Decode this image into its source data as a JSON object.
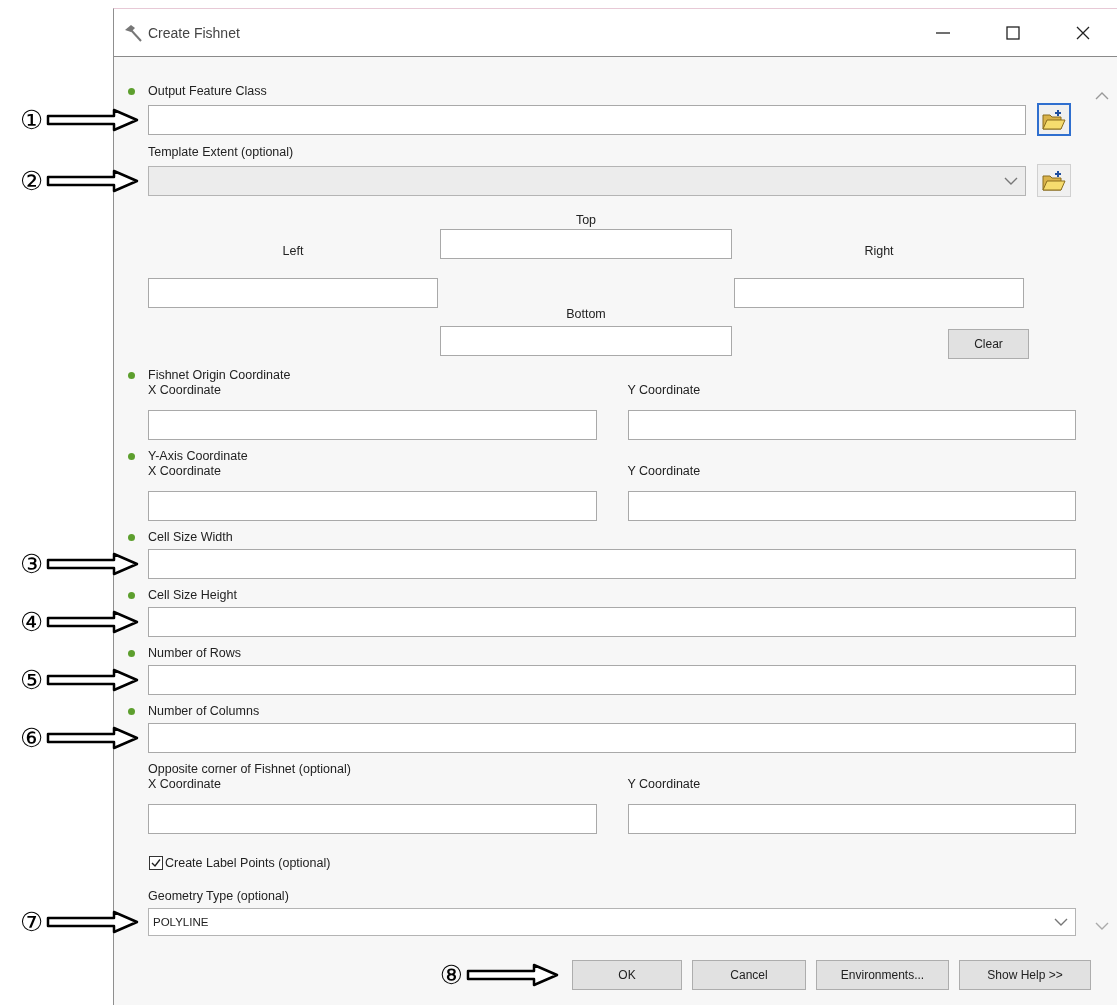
{
  "window": {
    "title": "Create Fishnet"
  },
  "params": [
    {
      "kind": "path",
      "label": "Output Feature Class",
      "required": true,
      "marker": "①",
      "browse": {
        "focused": true
      }
    },
    {
      "kind": "dropdown",
      "label": "Template Extent (optional)",
      "required": false,
      "marker": "②",
      "browse": {
        "focused": false
      }
    },
    {
      "kind": "extent",
      "top": "Top",
      "left": "Left",
      "right": "Right",
      "bottom": "Bottom",
      "clear": "Clear"
    },
    {
      "kind": "xy",
      "label": "Fishnet Origin Coordinate",
      "required": true,
      "x_label": "X Coordinate",
      "y_label": "Y Coordinate"
    },
    {
      "kind": "xy",
      "label": "Y-Axis Coordinate",
      "required": true,
      "x_label": "X Coordinate",
      "y_label": "Y Coordinate"
    },
    {
      "kind": "text",
      "label": "Cell Size Width",
      "required": true,
      "marker": "③"
    },
    {
      "kind": "text",
      "label": "Cell Size Height",
      "required": true,
      "marker": "④"
    },
    {
      "kind": "text",
      "label": "Number of Rows",
      "required": true,
      "marker": "⑤"
    },
    {
      "kind": "text",
      "label": "Number of Columns",
      "required": true,
      "marker": "⑥"
    },
    {
      "kind": "xy",
      "label": "Opposite corner of Fishnet (optional)",
      "required": false,
      "x_label": "X Coordinate",
      "y_label": "Y Coordinate"
    },
    {
      "kind": "checkbox",
      "label": "Create Label Points (optional)",
      "checked": true
    },
    {
      "kind": "dropdown",
      "label": "Geometry Type (optional)",
      "required": false,
      "marker": "⑦",
      "value": "POLYLINE"
    }
  ],
  "buttons": [
    {
      "label": "OK",
      "marker": "⑧"
    },
    {
      "label": "Cancel"
    },
    {
      "label": "Environments..."
    },
    {
      "label": "Show Help >>"
    }
  ]
}
